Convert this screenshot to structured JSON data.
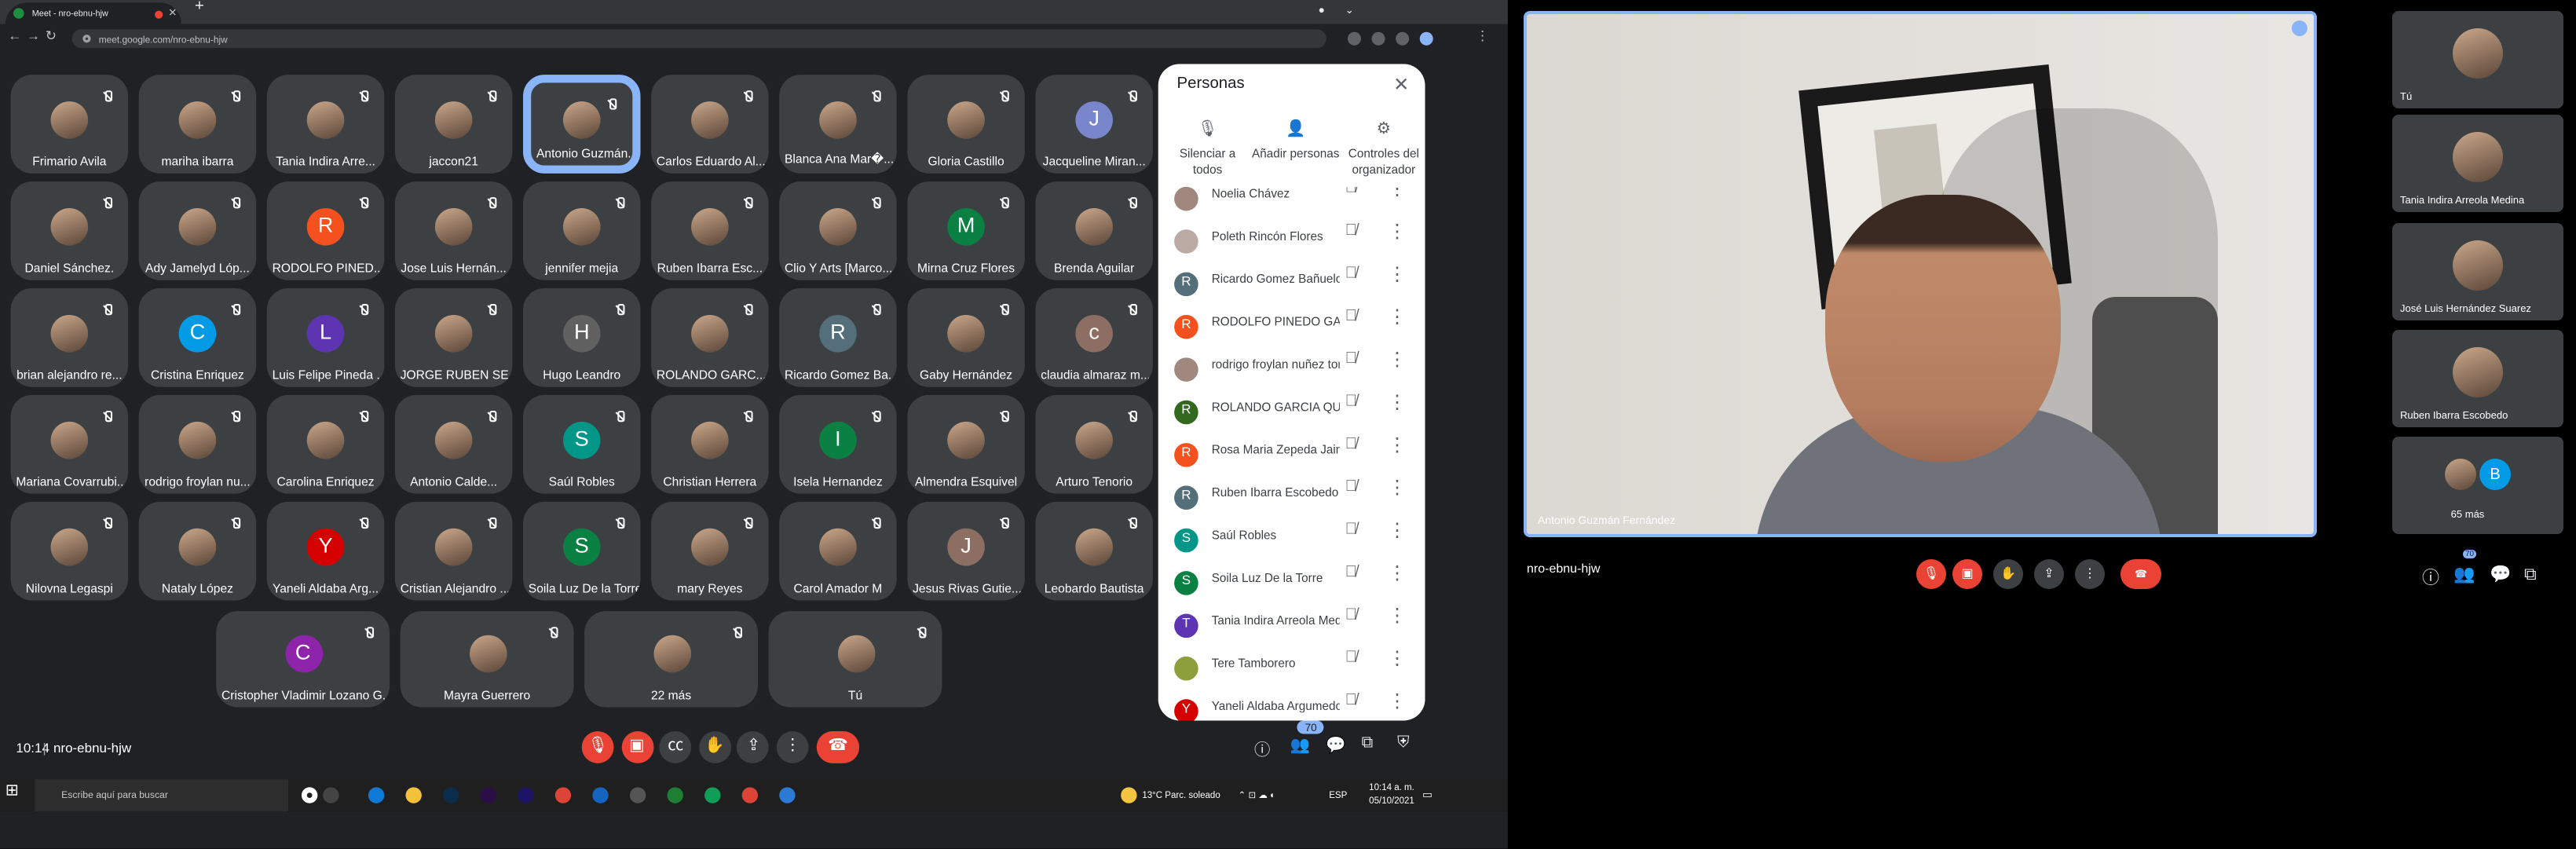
{
  "browser": {
    "tab_title": "Meet - nro-ebnu-hjw",
    "url": "meet.google.com/nro-ebnu-hjw"
  },
  "grid_tiles": [
    {
      "name": "Frimario Avila",
      "initial": "",
      "color": "",
      "photo": true
    },
    {
      "name": "mariha ibarra",
      "initial": "",
      "color": "",
      "photo": true
    },
    {
      "name": "Tania Indira Arre...",
      "initial": "",
      "color": "",
      "photo": true
    },
    {
      "name": "jaccon21",
      "initial": "",
      "color": "",
      "photo": true
    },
    {
      "name": "Antonio Guzmán...",
      "initial": "",
      "color": "",
      "photo": true
    },
    {
      "name": "Carlos Eduardo Al...",
      "initial": "",
      "color": "",
      "photo": true
    },
    {
      "name": "Blanca Ana Mar�...",
      "initial": "",
      "color": "",
      "photo": true
    },
    {
      "name": "Gloria Castillo",
      "initial": "",
      "color": "",
      "photo": true
    },
    {
      "name": "Jacqueline Miran...",
      "initial": "J",
      "color": "#7986cb",
      "photo": false
    },
    {
      "name": "Daniel Sánchez.",
      "initial": "",
      "color": "",
      "photo": true
    },
    {
      "name": "Ady Jamelyd Lóp...",
      "initial": "",
      "color": "",
      "photo": true
    },
    {
      "name": "RODOLFO PINED...",
      "initial": "R",
      "color": "#f4511e",
      "photo": false
    },
    {
      "name": "Jose Luis Hernán...",
      "initial": "",
      "color": "",
      "photo": true
    },
    {
      "name": "jennifer mejia",
      "initial": "",
      "color": "",
      "photo": true
    },
    {
      "name": "Ruben Ibarra Esc...",
      "initial": "",
      "color": "",
      "photo": true
    },
    {
      "name": "Clio Y Arts [Marco...",
      "initial": "",
      "color": "",
      "photo": true
    },
    {
      "name": "Mirna Cruz Flores",
      "initial": "M",
      "color": "#0b8043",
      "photo": false
    },
    {
      "name": "Brenda Aguilar",
      "initial": "",
      "color": "",
      "photo": true
    },
    {
      "name": "brian alejandro re...",
      "initial": "",
      "color": "",
      "photo": true
    },
    {
      "name": "Cristina Enriquez",
      "initial": "C",
      "color": "#039be5",
      "photo": false
    },
    {
      "name": "Luis Felipe Pineda ...",
      "initial": "L",
      "color": "#5e35b1",
      "photo": false
    },
    {
      "name": "JORGE RUBEN SE...",
      "initial": "",
      "color": "",
      "photo": true
    },
    {
      "name": "Hugo Leandro",
      "initial": "H",
      "color": "#616161",
      "photo": false
    },
    {
      "name": "ROLANDO GARC...",
      "initial": "",
      "color": "",
      "photo": true
    },
    {
      "name": "Ricardo Gomez Ba...",
      "initial": "R",
      "color": "#546e7a",
      "photo": false
    },
    {
      "name": "Gaby Hernández",
      "initial": "",
      "color": "",
      "photo": true
    },
    {
      "name": "claudia almaraz m...",
      "initial": "c",
      "color": "#8d6e63",
      "photo": false
    },
    {
      "name": "Mariana Covarrubi...",
      "initial": "",
      "color": "",
      "photo": true
    },
    {
      "name": "rodrigo froylan nu...",
      "initial": "",
      "color": "",
      "photo": true
    },
    {
      "name": "Carolina Enriquez",
      "initial": "",
      "color": "",
      "photo": true
    },
    {
      "name": "Antonio Calde...",
      "initial": "",
      "color": "",
      "photo": true
    },
    {
      "name": "Saúl Robles",
      "initial": "S",
      "color": "#009688",
      "photo": false
    },
    {
      "name": "Christian Herrera",
      "initial": "",
      "color": "",
      "photo": true
    },
    {
      "name": "Isela Hernandez",
      "initial": "I",
      "color": "#0b8043",
      "photo": false
    },
    {
      "name": "Almendra Esquivel",
      "initial": "",
      "color": "",
      "photo": true
    },
    {
      "name": "Arturo Tenorio",
      "initial": "",
      "color": "",
      "photo": true
    },
    {
      "name": "Nilovna Legaspi",
      "initial": "",
      "color": "",
      "photo": true
    },
    {
      "name": "Nataly López",
      "initial": "",
      "color": "",
      "photo": true
    },
    {
      "name": "Yaneli Aldaba Arg...",
      "initial": "Y",
      "color": "#d50000",
      "photo": false
    },
    {
      "name": "Cristian Alejandro ...",
      "initial": "",
      "color": "",
      "photo": true
    },
    {
      "name": "Soila Luz De la Torre",
      "initial": "S",
      "color": "#0b8043",
      "photo": false
    },
    {
      "name": "mary Reyes",
      "initial": "",
      "color": "",
      "photo": true
    },
    {
      "name": "Carol Amador M",
      "initial": "",
      "color": "",
      "photo": true
    },
    {
      "name": "Jesus Rivas Gutie...",
      "initial": "J",
      "color": "#8d6e63",
      "photo": false
    },
    {
      "name": "Leobardo Bautista",
      "initial": "",
      "color": "",
      "photo": true
    }
  ],
  "bottom_tiles": [
    {
      "name": "Cristopher Vladimir Lozano G...",
      "initial": "C",
      "color": "#8e24aa",
      "photo": false
    },
    {
      "name": "Mayra Guerrero",
      "initial": "",
      "color": "",
      "photo": true
    },
    {
      "name": "22 más",
      "initial": "",
      "color": "",
      "photo": true
    },
    {
      "name": "Tú",
      "initial": "",
      "color": "",
      "photo": true
    }
  ],
  "people_panel": {
    "title": "Personas",
    "actions": [
      "Silenciar a todos",
      "Añadir personas",
      "Controles del organizador"
    ],
    "list": [
      {
        "name": "Noelia Chávez",
        "initial": "",
        "color": "#a1887f"
      },
      {
        "name": "Poleth Rincón Flores",
        "initial": "",
        "color": "#bcaaa4"
      },
      {
        "name": "Ricardo Gomez Bañuelos",
        "initial": "R",
        "color": "#546e7a"
      },
      {
        "name": "RODOLFO PINEDO GAR...",
        "initial": "R",
        "color": "#f4511e"
      },
      {
        "name": "rodrigo froylan nuñez torr...",
        "initial": "",
        "color": "#a1887f"
      },
      {
        "name": "ROLANDO GARCIA QUIÑ...",
        "initial": "R",
        "color": "#33691e"
      },
      {
        "name": "Rosa Maria Zepeda Jaime",
        "initial": "R",
        "color": "#f4511e"
      },
      {
        "name": "Ruben Ibarra Escobedo",
        "initial": "R",
        "color": "#546e7a"
      },
      {
        "name": "Saúl Robles",
        "initial": "S",
        "color": "#009688"
      },
      {
        "name": "Soila Luz De la Torre",
        "initial": "S",
        "color": "#0b8043"
      },
      {
        "name": "Tania Indira Arreola Medina",
        "initial": "T",
        "color": "#5e35b1"
      },
      {
        "name": "Tere Tamborero",
        "initial": "",
        "color": "#8d9f3c"
      },
      {
        "name": "Yaneli Aldaba Argumedo",
        "initial": "Y",
        "color": "#d50000"
      }
    ]
  },
  "left_footer": {
    "time": "10:14",
    "separator": "|",
    "code": "nro-ebnu-hjw",
    "people_count": "70"
  },
  "taskbar": {
    "search_placeholder": "Escribe aquí para buscar",
    "weather": "13°C  Parc. soleado",
    "lang": "ESP",
    "clock_time": "10:14 a. m.",
    "clock_date": "05/10/2021"
  },
  "right": {
    "speaker_name": "Antonio Guzmán Fernández",
    "meeting_code": "nro-ebnu-hjw",
    "people_count": "70",
    "side_tiles": [
      "Tú",
      "Tania Indira Arreola Medina",
      "José Luis Hernández Suarez",
      "Ruben Ibarra Escobedo"
    ],
    "more_label": "65 más",
    "more_initial": "B"
  }
}
